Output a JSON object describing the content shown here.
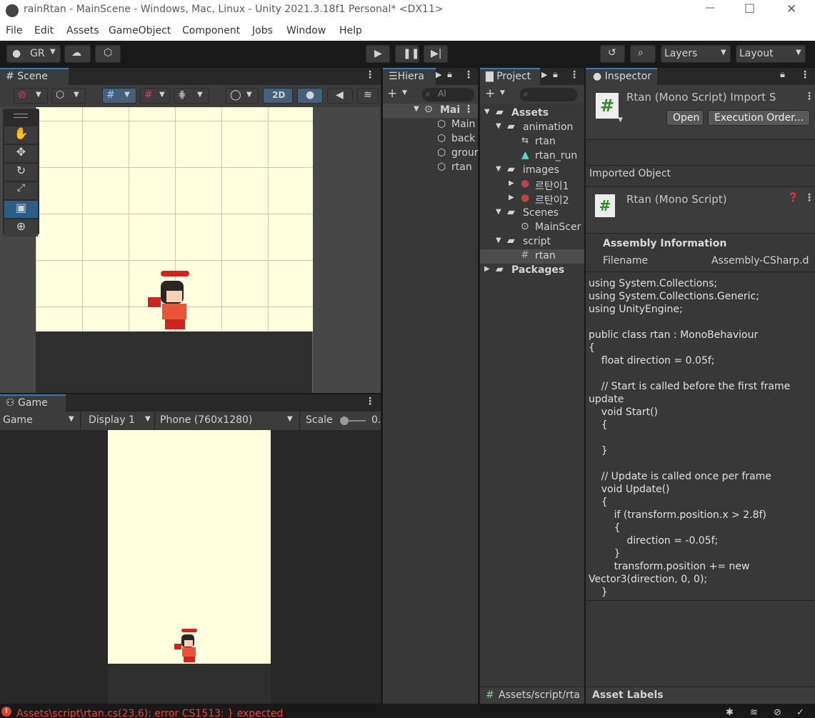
{
  "window": {
    "title": "rainRtan - MainScene - Windows, Mac, Linux - Unity 2021.3.18f1 Personal* <DX11>",
    "min": "—",
    "max": "☐",
    "close": "✕"
  },
  "menu": [
    "File",
    "Edit",
    "Assets",
    "GameObject",
    "Component",
    "Jobs",
    "Window",
    "Help"
  ],
  "toolbar": {
    "account": "GR",
    "layers": "Layers",
    "layout": "Layout"
  },
  "scene": {
    "tab": "Scene",
    "mode2d": "2D"
  },
  "game": {
    "tab": "Game",
    "view": "Game",
    "display": "Display 1",
    "resolution": "Phone (760x1280)",
    "scale_label": "Scale",
    "scale_value": "0."
  },
  "hierarchy": {
    "tab": "Hiera",
    "search": "Al",
    "scene": "Mai",
    "items": [
      "Main",
      "back",
      "grour",
      "rtan"
    ]
  },
  "project": {
    "tab": "Project",
    "assets": "Assets",
    "animation": "animation",
    "anim_items": [
      "rtan",
      "rtan_run"
    ],
    "images": "images",
    "image_items": [
      "르탄이1",
      "르탄이2"
    ],
    "scenes": "Scenes",
    "scene_item": "MainScer",
    "script": "script",
    "script_item": "rtan",
    "packages": "Packages",
    "path": "Assets/script/rta"
  },
  "inspector": {
    "tab": "Inspector",
    "title": "Rtan (Mono Script) Import S",
    "open": "Open",
    "exec_order": "Execution Order...",
    "imported_object": "Imported Object",
    "sub_title": "Rtan (Mono Script)",
    "assembly_info": "Assembly Information",
    "filename_label": "Filename",
    "filename_value": "Assembly-CSharp.d",
    "asset_labels": "Asset Labels",
    "code": [
      "using System.Collections;",
      "using System.Collections.Generic;",
      "using UnityEngine;",
      "",
      "public class rtan : MonoBehaviour",
      "{",
      "    float direction = 0.05f;",
      "",
      "    // Start is called before the first frame",
      "update",
      "    void Start()",
      "    {",
      "",
      "    }",
      "",
      "    // Update is called once per frame",
      "    void Update()",
      "    {",
      "        if (transform.position.x > 2.8f)",
      "        {",
      "            direction = -0.05f;",
      "        }",
      "        transform.position += new",
      "Vector3(direction, 0, 0);",
      "    }"
    ]
  },
  "status": {
    "error": "Assets\\script\\rtan.cs(23,6): error CS1513: } expected"
  }
}
